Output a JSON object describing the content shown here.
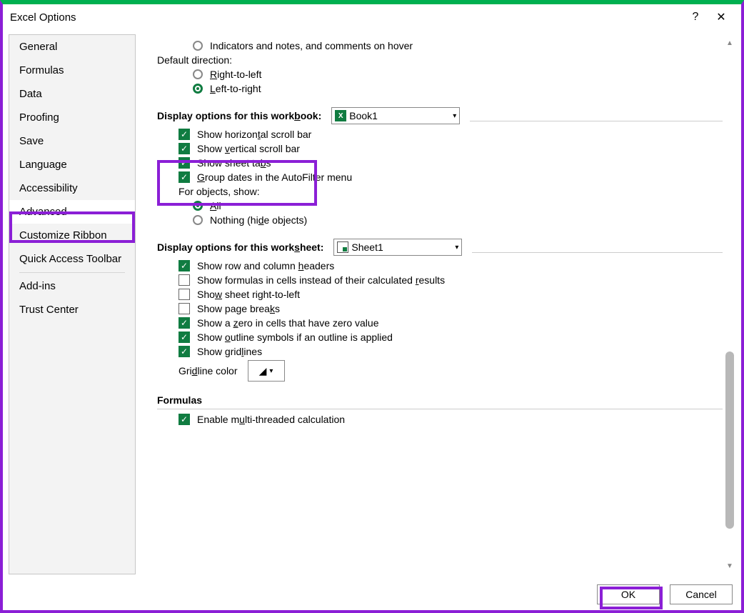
{
  "window": {
    "title": "Excel Options",
    "help_icon": "?",
    "close_icon": "✕"
  },
  "sidebar": {
    "items": [
      {
        "label": "General",
        "selected": false
      },
      {
        "label": "Formulas",
        "selected": false
      },
      {
        "label": "Data",
        "selected": false
      },
      {
        "label": "Proofing",
        "selected": false
      },
      {
        "label": "Save",
        "selected": false
      },
      {
        "label": "Language",
        "selected": false
      },
      {
        "label": "Accessibility",
        "selected": false
      },
      {
        "label": "Advanced",
        "selected": true
      },
      {
        "label": "Customize Ribbon",
        "selected": false
      },
      {
        "label": "Quick Access Toolbar",
        "selected": false
      }
    ],
    "items2": [
      {
        "label": "Add-ins"
      },
      {
        "label": "Trust Center"
      }
    ]
  },
  "content": {
    "top_radios": {
      "opt1": "Indicators and notes, and comments on hover"
    },
    "default_direction_label": "Default direction:",
    "dir_rtl": "Right-to-left",
    "dir_ltr": "Left-to-right",
    "workbook_section": "Display options for this workbook:",
    "workbook_select": "Book1",
    "wb_opts": {
      "hscroll": "Show horizontal scroll bar",
      "vscroll": "Show vertical scroll bar",
      "tabs": "Show sheet tabs",
      "groupdates": "Group dates in the AutoFilter menu"
    },
    "objects_label": "For objects, show:",
    "objects_all": "All",
    "objects_nothing": "Nothing (hide objects)",
    "worksheet_section": "Display options for this worksheet:",
    "worksheet_select": "Sheet1",
    "ws_opts": {
      "headers": "Show row and column headers",
      "formulas": "Show formulas in cells instead of their calculated results",
      "rtl": "Show sheet right-to-left",
      "pagebreaks": "Show page breaks",
      "zero": "Show a zero in cells that have zero value",
      "outline": "Show outline symbols if an outline is applied",
      "gridlines": "Show gridlines"
    },
    "gridline_color_label": "Gridline color",
    "formulas_section": "Formulas",
    "multithread": "Enable multi-threaded calculation"
  },
  "footer": {
    "ok": "OK",
    "cancel": "Cancel"
  }
}
